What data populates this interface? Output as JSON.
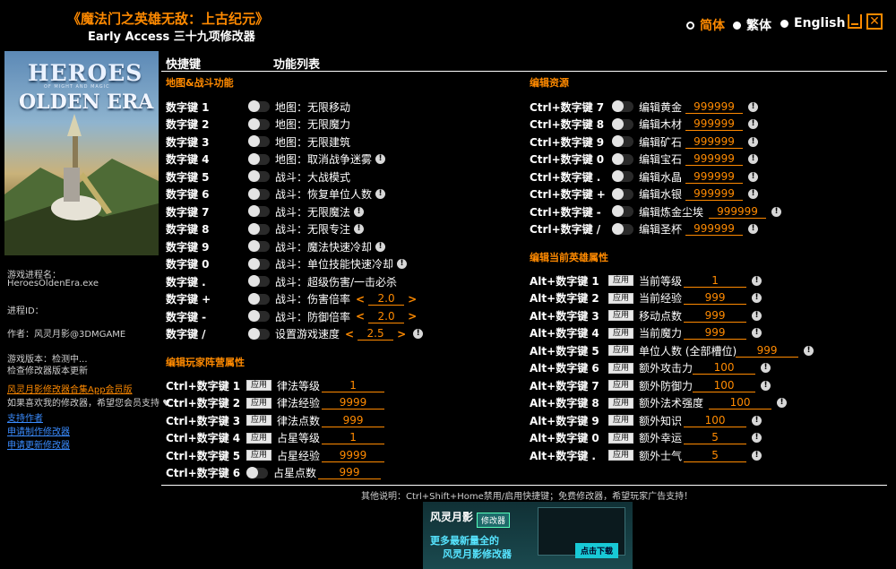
{
  "window": {
    "title": "《魔法门之英雄无敌：上古纪元》",
    "subtitle": "Early Access 三十九项修改器",
    "languages": [
      {
        "label": "简体",
        "active": true
      },
      {
        "label": "繁体",
        "active": false
      },
      {
        "label": "English",
        "active": false
      }
    ]
  },
  "cover": {
    "logo_line1": "HEROES",
    "logo_line2": "OF MIGHT AND MAGIC",
    "logo_line3": "OLDEN ERA"
  },
  "left_info": {
    "process_label": "游戏进程名：",
    "process_value": "HeroesOldenEra.exe",
    "pid_label": "进程ID：",
    "author": "作者：风灵月影@3DMGAME",
    "version_label": "游戏版本：检测中...",
    "update_check": "检查修改器版本更新",
    "app_link": "风灵月影修改器合集App会员版",
    "support_text": "如果喜欢我的修改器，希望您会员支持 ♥",
    "support_author": "支持作者",
    "request_new": "申请制作修改器",
    "request_update": "申请更新修改器"
  },
  "headers": {
    "key": "快捷键",
    "func": "功能列表"
  },
  "sections": {
    "map_battle": "地图&战斗功能",
    "player_camp": "编辑玩家阵营属性",
    "edit_resources": "编辑资源",
    "edit_hero": "编辑当前英雄属性"
  },
  "map_battle_rows": [
    {
      "key": "数字键 1",
      "label": "地图：无限移动",
      "bang": false
    },
    {
      "key": "数字键 2",
      "label": "地图：无限魔力",
      "bang": false
    },
    {
      "key": "数字键 3",
      "label": "地图：无限建筑",
      "bang": false
    },
    {
      "key": "数字键 4",
      "label": "地图：取消战争迷雾",
      "bang": true
    },
    {
      "key": "数字键 5",
      "label": "战斗：大战模式",
      "bang": false
    },
    {
      "key": "数字键 6",
      "label": "战斗：恢复单位人数",
      "bang": true
    },
    {
      "key": "数字键 7",
      "label": "战斗：无限魔法",
      "bang": true
    },
    {
      "key": "数字键 8",
      "label": "战斗：无限专注",
      "bang": true
    },
    {
      "key": "数字键 9",
      "label": "战斗：魔法快速冷却",
      "bang": true
    },
    {
      "key": "数字键 0",
      "label": "战斗：单位技能快速冷却",
      "bang": true
    },
    {
      "key": "数字键 .",
      "label": "战斗：超级伤害/一击必杀",
      "bang": false
    },
    {
      "key": "数字键 +",
      "label": "战斗：伤害倍率",
      "value": "2.0",
      "bang": false
    },
    {
      "key": "数字键 -",
      "label": "战斗：防御倍率",
      "value": "2.0",
      "bang": false
    },
    {
      "key": "数字键 /",
      "label": "设置游戏速度",
      "value": "2.5",
      "bang": true
    }
  ],
  "player_rows": [
    {
      "key": "Ctrl+数字键 1",
      "apply": "应用",
      "label": "律法等级",
      "value": "1"
    },
    {
      "key": "Ctrl+数字键 2",
      "apply": "应用",
      "label": "律法经验",
      "value": "9999"
    },
    {
      "key": "Ctrl+数字键 3",
      "apply": "应用",
      "label": "律法点数",
      "value": "999"
    },
    {
      "key": "Ctrl+数字键 4",
      "apply": "应用",
      "label": "占星等级",
      "value": "1"
    },
    {
      "key": "Ctrl+数字键 5",
      "apply": "应用",
      "label": "占星经验",
      "value": "9999"
    },
    {
      "key": "Ctrl+数字键 6",
      "apply": "",
      "label": "占星点数",
      "value": "999"
    }
  ],
  "resource_rows": [
    {
      "key": "Ctrl+数字键 7",
      "label": "编辑黄金",
      "value": "999999"
    },
    {
      "key": "Ctrl+数字键 8",
      "label": "编辑木材",
      "value": "999999"
    },
    {
      "key": "Ctrl+数字键 9",
      "label": "编辑矿石",
      "value": "999999"
    },
    {
      "key": "Ctrl+数字键 0",
      "label": "编辑宝石",
      "value": "999999"
    },
    {
      "key": "Ctrl+数字键 .",
      "label": "编辑水晶",
      "value": "999999"
    },
    {
      "key": "Ctrl+数字键 +",
      "label": "编辑水银",
      "value": "999999"
    },
    {
      "key": "Ctrl+数字键 -",
      "label": "编辑炼金尘埃",
      "value": "999999"
    },
    {
      "key": "Ctrl+数字键 /",
      "label": "编辑圣杯",
      "value": "999999"
    }
  ],
  "hero_rows": [
    {
      "key": "Alt+数字键 1",
      "apply": "应用",
      "label": "当前等级",
      "value": "1"
    },
    {
      "key": "Alt+数字键 2",
      "apply": "应用",
      "label": "当前经验",
      "value": "999"
    },
    {
      "key": "Alt+数字键 3",
      "apply": "应用",
      "label": "移动点数",
      "value": "999"
    },
    {
      "key": "Alt+数字键 4",
      "apply": "应用",
      "label": "当前魔力",
      "value": "999"
    },
    {
      "key": "Alt+数字键 5",
      "apply": "应用",
      "label": "单位人数 (全部槽位)",
      "value": "999"
    },
    {
      "key": "Alt+数字键 6",
      "apply": "应用",
      "label": "额外攻击力",
      "value": "100"
    },
    {
      "key": "Alt+数字键 7",
      "apply": "应用",
      "label": "额外防御力",
      "value": "100"
    },
    {
      "key": "Alt+数字键 8",
      "apply": "应用",
      "label": "额外法术强度",
      "value": "100"
    },
    {
      "key": "Alt+数字键 9",
      "apply": "应用",
      "label": "额外知识",
      "value": "100"
    },
    {
      "key": "Alt+数字键 0",
      "apply": "应用",
      "label": "额外幸运",
      "value": "5"
    },
    {
      "key": "Alt+数字键 .",
      "apply": "应用",
      "label": "额外士气",
      "value": "5"
    }
  ],
  "footer": {
    "note": "其他说明：Ctrl+Shift+Home禁用/启用快捷键；免费修改器，希望玩家广告支持！"
  },
  "banner": {
    "logo": "风灵月影",
    "tag": "修改器",
    "line1": "更多最新量全的",
    "line2": "风灵月影修改器",
    "button": "点击下载"
  },
  "colors": {
    "accent": "#ff8a00",
    "link": "#3a8cff",
    "background": "#000000"
  }
}
